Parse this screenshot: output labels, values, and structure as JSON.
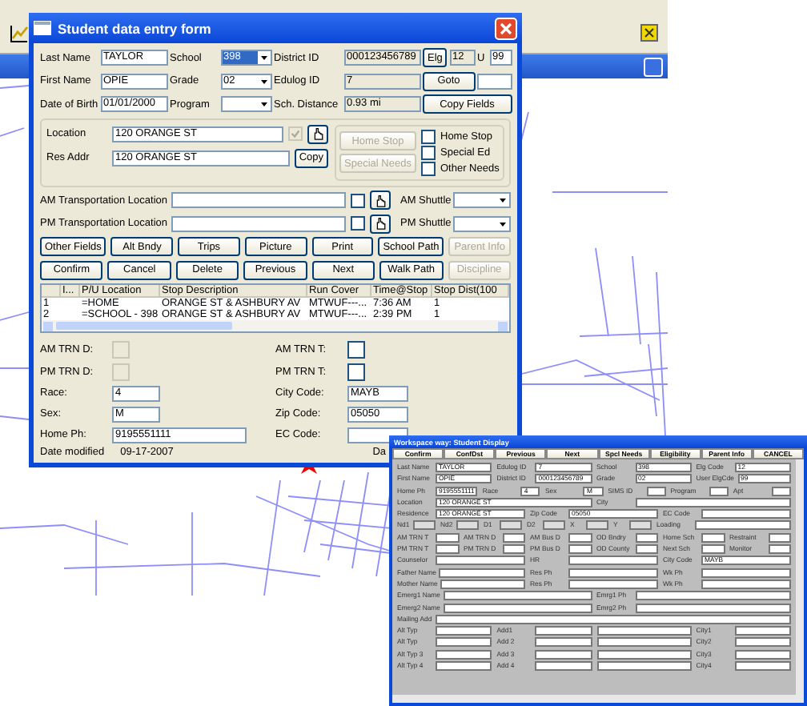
{
  "form": {
    "title": "Student data entry form",
    "last_name": {
      "label": "Last Name",
      "value": "TAYLOR"
    },
    "school": {
      "label": "School",
      "value": "398",
      "focused": true
    },
    "district_id": {
      "label": "District ID",
      "value": "000123456789"
    },
    "elg_button": {
      "label": "Elg",
      "disabled": false
    },
    "elg": {
      "value": "12"
    },
    "u": {
      "label": "U",
      "value": "99"
    },
    "first_name": {
      "label": "First Name",
      "value": "OPIE"
    },
    "grade": {
      "label": "Grade",
      "value": "02",
      "focused": false
    },
    "edulog_id": {
      "label": "Edulog ID",
      "value": "7"
    },
    "goto_button": {
      "label": "Goto",
      "disabled": false
    },
    "dob": {
      "label": "Date of Birth",
      "value": "01/01/2000"
    },
    "program": {
      "label": "Program"
    },
    "sch_distance": {
      "label": "Sch. Distance",
      "value": "0.93 mi"
    },
    "copy_fields": {
      "label": "Copy Fields",
      "disabled": false
    },
    "location": {
      "label": "Location",
      "value": "120 ORANGE ST",
      "checked": true
    },
    "res_addr": {
      "label": "Res Addr",
      "value": "120 ORANGE ST"
    },
    "copy": {
      "label": "Copy",
      "disabled": false
    },
    "home_stop_button": {
      "label": "Home Stop",
      "disabled": true
    },
    "special_needs_button": {
      "label": "Special Needs",
      "disabled": true
    },
    "options": [
      {
        "label": "Home Stop",
        "checked": false
      },
      {
        "label": "Special Ed",
        "checked": false
      },
      {
        "label": "Other Needs",
        "checked": false
      }
    ],
    "transport": [
      {
        "label": "AM Transportation Location",
        "checked": false,
        "shuttle_label": "AM Shuttle"
      },
      {
        "label": "PM Transportation Location",
        "checked": false,
        "shuttle_label": "PM Shuttle"
      }
    ],
    "buttons": [
      [
        {
          "label": "Other Fields",
          "disabled": false
        },
        {
          "label": "Alt Bndy",
          "disabled": false
        },
        {
          "label": "Trips",
          "disabled": false
        },
        {
          "label": "Picture",
          "disabled": false
        },
        {
          "label": "Print",
          "disabled": false
        },
        {
          "label": "School Path",
          "disabled": false
        },
        {
          "label": "Parent Info",
          "disabled": true
        }
      ],
      [
        {
          "label": "Confirm",
          "disabled": false
        },
        {
          "label": "Cancel",
          "disabled": false
        },
        {
          "label": "Delete",
          "disabled": false
        },
        {
          "label": "Previous",
          "disabled": false
        },
        {
          "label": "Next",
          "disabled": false
        },
        {
          "label": "Walk Path",
          "disabled": false
        },
        {
          "label": "Discipline",
          "disabled": true
        }
      ]
    ],
    "stops": {
      "columns": [
        "I...",
        "P/U Location",
        "Stop Description",
        "Run Cover",
        "Time@Stop",
        "Stop Dist(100"
      ],
      "rows": [
        {
          "number": "1",
          "pu_location": "=HOME",
          "stop_description": "ORANGE ST & ASHBURY AV",
          "run_cover": "MTWUF---...",
          "time": "7:36 AM",
          "stop_dist": "1"
        },
        {
          "number": "2",
          "pu_location": "=SCHOOL - 398",
          "stop_description": "ORANGE ST & ASHBURY AV",
          "run_cover": "MTWUF---...",
          "time": "2:39 PM",
          "stop_dist": "1"
        }
      ]
    },
    "lower": [
      [
        {
          "kind": "check",
          "label": "AM TRN D:",
          "checked": false,
          "disabled": true
        },
        {
          "kind": "check",
          "label": "AM TRN T:",
          "checked": false,
          "disabled": false
        }
      ],
      [
        {
          "kind": "check",
          "label": "PM TRN D:",
          "checked": false,
          "disabled": true
        },
        {
          "kind": "check",
          "label": "PM TRN T:",
          "checked": false,
          "disabled": false
        }
      ],
      [
        {
          "kind": "input",
          "label": "Race:",
          "value": "4"
        },
        {
          "kind": "input",
          "label": "City Code:",
          "value": "MAYB"
        }
      ],
      [
        {
          "kind": "input",
          "label": "Sex:",
          "value": "M"
        },
        {
          "kind": "input",
          "label": "Zip Code:",
          "value": "05050"
        }
      ],
      [
        {
          "kind": "input",
          "label": "Home Ph:",
          "value": "9195551111"
        },
        {
          "kind": "input",
          "label": "EC Code:"
        }
      ]
    ],
    "date_modified": {
      "label": "Date modified",
      "value": "09-17-2007"
    },
    "date_cut": "Da"
  },
  "display": {
    "title": "Workspace way: Student Display",
    "buttons": [
      "Confirm",
      "ConfDst",
      "Previous",
      "Next",
      "Spcl Needs",
      "Eligibility",
      "Parent Info",
      "CANCEL"
    ],
    "rows": [
      [
        {
          "label": "Last Name",
          "value": "TAYLOR"
        },
        {
          "label": "Edulog ID",
          "value": "7"
        },
        {
          "label": "School",
          "value": "398"
        },
        {
          "label": "Elg Code",
          "value": "12"
        }
      ],
      [
        {
          "label": "First Name",
          "value": "OPIE"
        },
        {
          "label": "District ID",
          "value": "000123456789"
        },
        {
          "label": "Grade",
          "value": "02"
        },
        {
          "label": "User ElgCde",
          "value": "99"
        }
      ],
      [
        {
          "label": "Home Ph",
          "value": "9195551111"
        },
        {
          "label": "Race",
          "value": "4"
        },
        {
          "label": "Sex",
          "value": "M"
        },
        {
          "label": "SIMS ID"
        },
        {
          "label": "Program"
        },
        {
          "label": "Apt"
        }
      ],
      [
        {
          "label": "Location",
          "value": "120 ORANGE ST"
        },
        {
          "label": "City"
        }
      ],
      [
        {
          "label": "Residence",
          "value": "120 ORANGE ST"
        },
        {
          "label": "Zip Code",
          "value": "05050"
        },
        {
          "label": "EC Code"
        }
      ],
      [
        {
          "label": "Nd1",
          "disabled": true
        },
        {
          "label": "Nd2",
          "disabled": true
        },
        {
          "label": "D1",
          "disabled": true
        },
        {
          "label": "D2",
          "disabled": true
        },
        {
          "label": "X",
          "disabled": true
        },
        {
          "label": "Y",
          "disabled": true
        },
        {
          "label": "Loading"
        }
      ],
      [
        {
          "label": "AM TRN T"
        },
        {
          "label": "AM TRN D"
        },
        {
          "label": "AM Bus D"
        },
        {
          "label": "OD Bndry"
        },
        {
          "label": "Home Sch"
        },
        {
          "label": "Restraint"
        }
      ],
      [
        {
          "label": "PM TRN T"
        },
        {
          "label": "PM TRN D"
        },
        {
          "label": "PM Bus D"
        },
        {
          "label": "OD County"
        },
        {
          "label": "Next Sch"
        },
        {
          "label": "Monitor"
        }
      ],
      [
        {
          "label": "Counselor"
        },
        {
          "label": "HR"
        },
        {
          "label": "City Code",
          "value": "MAYB"
        }
      ],
      [
        {
          "label": "Father Name"
        },
        {
          "label": "Res Ph"
        },
        {
          "label": "Wk Ph"
        }
      ],
      [
        {
          "label": "Mother Name"
        },
        {
          "label": "Res Ph"
        },
        {
          "label": "Wk Ph"
        }
      ],
      [
        {
          "label": "Emerg1 Name"
        },
        {
          "label": "Emrg1 Ph"
        }
      ],
      [
        {
          "label": "Emerg2 Name"
        },
        {
          "label": "Emrg2 Ph"
        }
      ],
      [
        {
          "label": "Mailing Add"
        }
      ],
      [
        {
          "label": "Alt Typ"
        },
        {
          "label": "Add1"
        },
        {},
        {
          "label": "City1"
        }
      ],
      [
        {
          "label": "Alt Typ"
        },
        {
          "label": "Add 2"
        },
        {},
        {
          "label": "City2"
        }
      ],
      [
        {
          "label": "Alt Typ 3"
        },
        {
          "label": "Add 3"
        },
        {},
        {
          "label": "City3"
        }
      ],
      [
        {
          "label": "Alt Typ 4"
        },
        {
          "label": "Add 4"
        },
        {},
        {
          "label": "City4"
        }
      ]
    ]
  }
}
